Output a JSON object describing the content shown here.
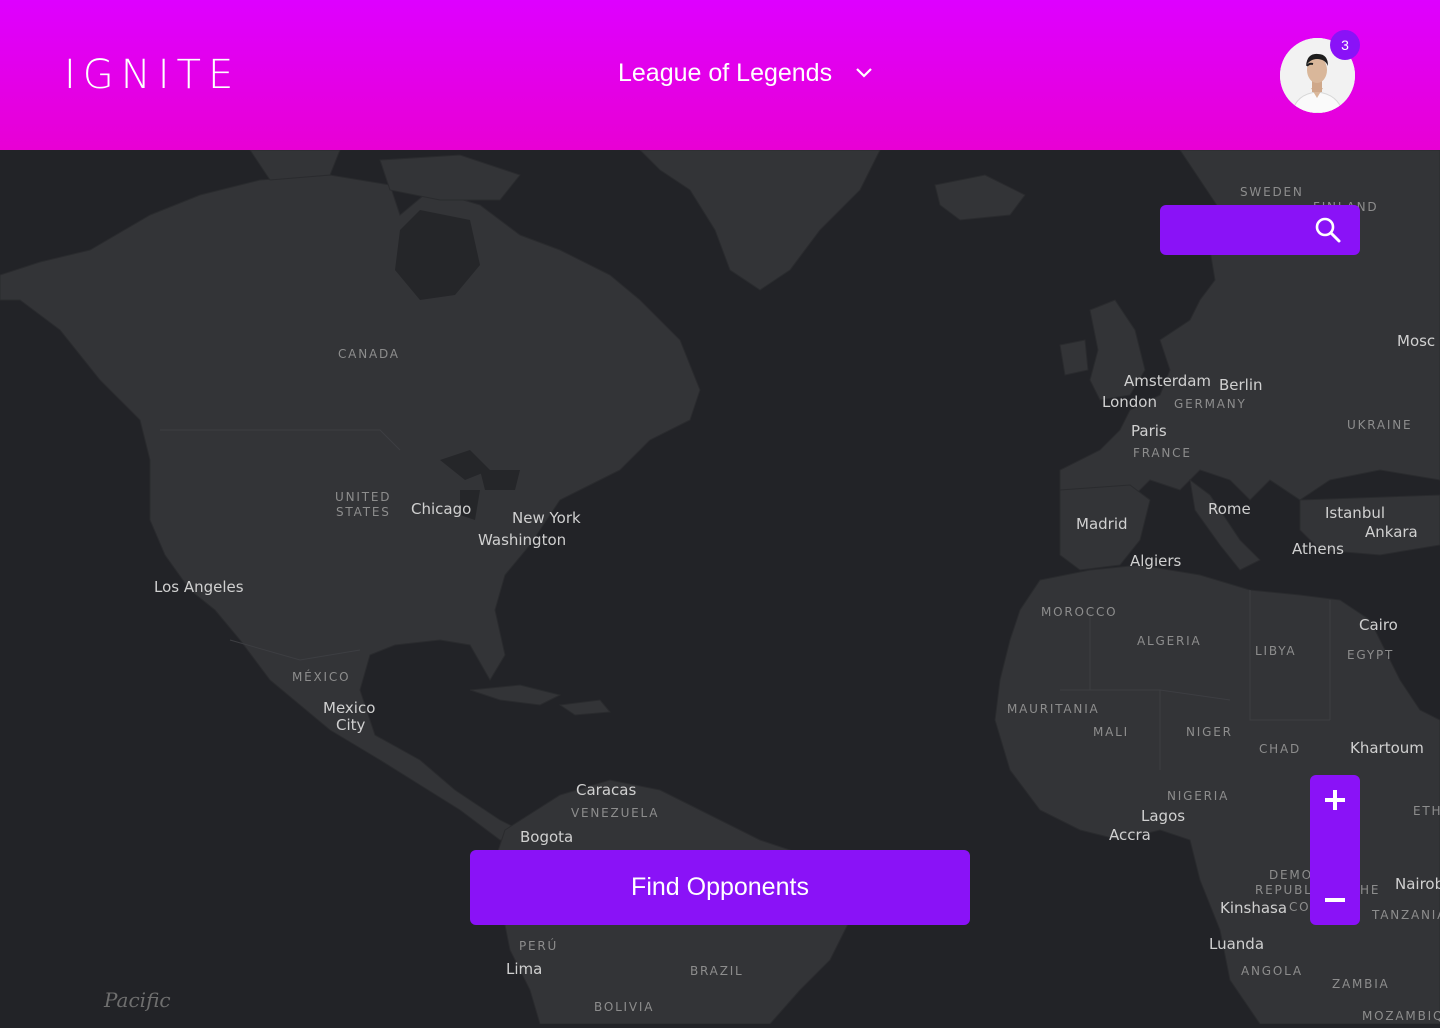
{
  "header": {
    "logo": "IGNITE",
    "game_selector": {
      "selected": "League of Legends"
    },
    "notification_count": "3"
  },
  "search": {
    "placeholder": ""
  },
  "zoom": {
    "in_label": "+",
    "out_label": "−"
  },
  "cta": {
    "label": "Find Opponents"
  },
  "map": {
    "cities": {
      "chicago": "Chicago",
      "new_york": "New York",
      "washington": "Washington",
      "los_angeles": "Los Angeles",
      "mexico_city_1": "Mexico",
      "mexico_city_2": "City",
      "caracas": "Caracas",
      "bogota": "Bogota",
      "lima": "Lima",
      "amsterdam": "Amsterdam",
      "berlin": "Berlin",
      "london": "London",
      "paris": "Paris",
      "madrid": "Madrid",
      "rome": "Rome",
      "istanbul": "Istanbul",
      "ankara": "Ankara",
      "athens": "Athens",
      "algiers": "Algiers",
      "cairo": "Cairo",
      "khartoum": "Khartoum",
      "lagos": "Lagos",
      "accra": "Accra",
      "kinshasa": "Kinshasa",
      "luanda": "Luanda",
      "nairobi": "Nairob",
      "moscow": "Mosc"
    },
    "countries": {
      "canada": "CANADA",
      "united_states_1": "UNITED",
      "united_states_2": "STATES",
      "mexico": "MÉXICO",
      "venezuela": "VENEZUELA",
      "peru": "PERÚ",
      "brazil": "BRAZIL",
      "bolivia": "BOLIVIA",
      "sweden": "SWEDEN",
      "finland": "FINLAND",
      "germany": "GERMANY",
      "france": "FRANCE",
      "ukraine": "UKRAINE",
      "morocco": "MOROCCO",
      "algeria": "ALGERIA",
      "libya": "LIBYA",
      "egypt": "EGYPT",
      "mauritania": "MAURITANIA",
      "mali": "MALI",
      "niger": "NIGER",
      "chad": "CHAD",
      "nigeria": "NIGERIA",
      "drc_1": "DEMO",
      "drc_2": "REPUBLI",
      "drc_3": "CO",
      "drc_4": "HE",
      "ethiopia": "ETH",
      "tanzania": "TANZANIA",
      "angola": "ANGOLA",
      "zambia": "ZAMBIA",
      "mozambique": "MOZAMBIQ"
    },
    "oceans": {
      "pacific": "Pacific"
    }
  },
  "colors": {
    "header_start": "#de00ff",
    "header_end": "#e800d4",
    "accent": "#8a12f7",
    "map_ocean": "#222327",
    "map_land": "#333437"
  }
}
